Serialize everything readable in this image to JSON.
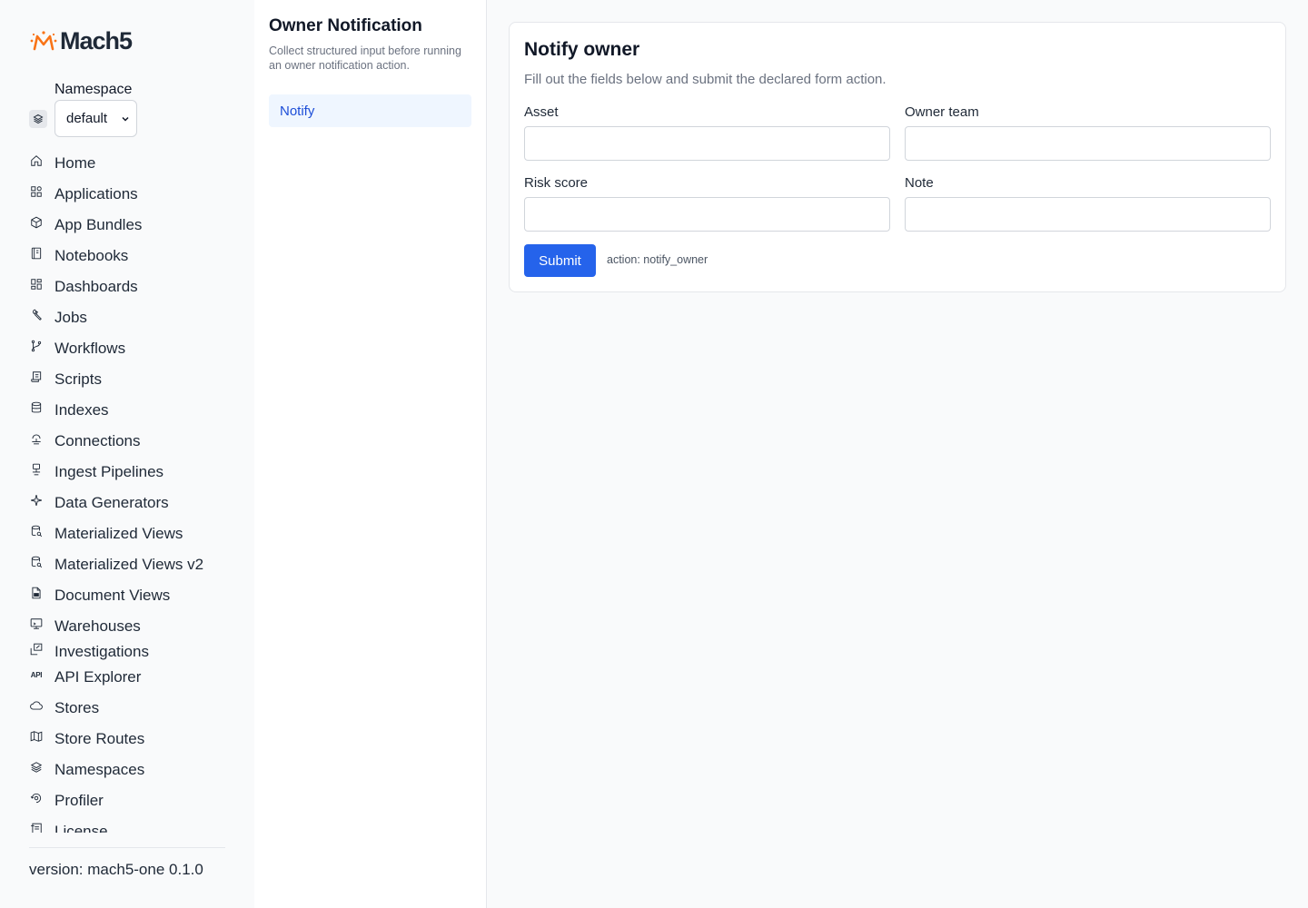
{
  "app": {
    "logo_text": "Mach5",
    "brand_color": "#f97316",
    "accent_color": "#2563eb"
  },
  "namespace": {
    "label": "Namespace",
    "selected": "default"
  },
  "nav": {
    "items": [
      {
        "label": "Home",
        "icon": "home-icon"
      },
      {
        "label": "Applications",
        "icon": "applications-icon"
      },
      {
        "label": "App Bundles",
        "icon": "package-icon"
      },
      {
        "label": "Notebooks",
        "icon": "notebook-icon"
      },
      {
        "label": "Dashboards",
        "icon": "dashboard-icon"
      },
      {
        "label": "Jobs",
        "icon": "wrench-icon"
      },
      {
        "label": "Workflows",
        "icon": "git-branch-icon"
      },
      {
        "label": "Scripts",
        "icon": "script-icon"
      },
      {
        "label": "Indexes",
        "icon": "database-icon"
      },
      {
        "label": "Connections",
        "icon": "connection-icon"
      },
      {
        "label": "Ingest Pipelines",
        "icon": "pipeline-icon"
      },
      {
        "label": "Data Generators",
        "icon": "sparkle-icon"
      },
      {
        "label": "Materialized Views",
        "icon": "database-search-icon"
      },
      {
        "label": "Materialized Views v2",
        "icon": "database-search-icon"
      },
      {
        "label": "Document Views",
        "icon": "file-icon"
      },
      {
        "label": "Warehouses",
        "icon": "monitor-icon"
      },
      {
        "label": "Investigations",
        "icon": "investigation-icon"
      },
      {
        "label": "API Explorer",
        "icon": "api-icon"
      },
      {
        "label": "Stores",
        "icon": "cloud-icon"
      },
      {
        "label": "Store Routes",
        "icon": "map-icon"
      },
      {
        "label": "Namespaces",
        "icon": "layers-icon"
      },
      {
        "label": "Profiler",
        "icon": "profiler-icon"
      },
      {
        "label": "License",
        "icon": "license-icon"
      }
    ],
    "api_icon_text": "API"
  },
  "footer": {
    "version": "version: mach5-one 0.1.0"
  },
  "panel": {
    "title": "Owner Notification",
    "description": "Collect structured input before running an owner notification action.",
    "items": [
      {
        "label": "Notify",
        "active": true
      }
    ]
  },
  "form": {
    "title": "Notify owner",
    "description": "Fill out the fields below and submit the declared form action.",
    "fields": [
      {
        "label": "Asset",
        "value": ""
      },
      {
        "label": "Owner team",
        "value": ""
      },
      {
        "label": "Risk score",
        "value": ""
      },
      {
        "label": "Note",
        "value": ""
      }
    ],
    "submit_label": "Submit",
    "action_text": "action: notify_owner"
  }
}
